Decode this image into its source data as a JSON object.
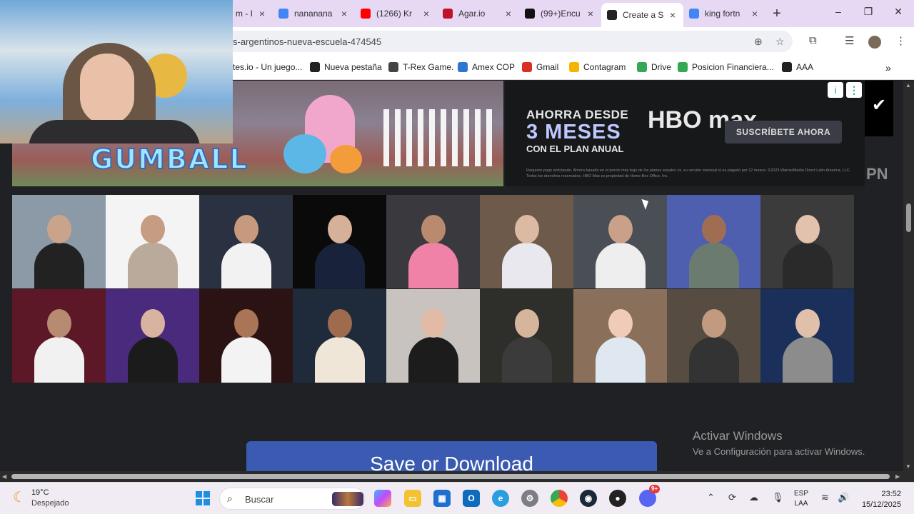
{
  "browser": {
    "tabs": [
      {
        "title": "m - I",
        "icon": "page-icon",
        "color": "#888888"
      },
      {
        "title": "nananana",
        "icon": "google-icon",
        "color": "#4285f4"
      },
      {
        "title": "(1266) Kr",
        "icon": "youtube-icon",
        "color": "#ff0000"
      },
      {
        "title": "Agar.io",
        "icon": "agar-icon",
        "color": "#c0102a"
      },
      {
        "title": "(99+)Encu",
        "icon": "tiktok-icon",
        "color": "#111111"
      },
      {
        "title": "Create a S",
        "icon": "create-icon",
        "color": "#222222",
        "active": true
      },
      {
        "title": "king fortn",
        "icon": "google-icon",
        "color": "#4285f4"
      }
    ],
    "new_tab_symbol": "+",
    "window_controls": {
      "minimize": "–",
      "restore": "❐",
      "close": "✕"
    },
    "url": "s-argentinos-nueva-escuela-474545",
    "bookmarks": [
      {
        "label": "tes.io - Un juego...",
        "icon": "page-icon",
        "color": "#ffffff"
      },
      {
        "label": "Nueva pestaña",
        "icon": "globe-icon",
        "color": "#222222"
      },
      {
        "label": "T-Rex Game.",
        "icon": "dino-icon",
        "color": "#444444"
      },
      {
        "label": "Amex COP",
        "icon": "amex-icon",
        "color": "#2e77d0"
      },
      {
        "label": "Gmail",
        "icon": "gmail-icon",
        "color": "#d93025"
      },
      {
        "label": "Contagram",
        "icon": "contagram-icon",
        "color": "#f4b400"
      },
      {
        "label": "Drive",
        "icon": "drive-icon",
        "color": "#34a853"
      },
      {
        "label": "Posicion Financiera...",
        "icon": "drive-icon",
        "color": "#34a853"
      },
      {
        "label": "AAA",
        "icon": "triangle-icon",
        "color": "#222222"
      }
    ]
  },
  "ad": {
    "line1": "AHORRA DESDE",
    "line2": "3 MESES",
    "line3": "CON EL PLAN ANUAL",
    "brand": "HBO max",
    "cta": "SUSCRÍBETE AHORA",
    "fine_print": "Requiere pago anticipado. Ahorra basado en el precio más bajo de los planes anuales vs. su versión mensual si es pagado por 12 meses. ©2023 WarnerMedia Direct Latin America, LLC. Todos los derechos reservados. HBO Max es propiedad de Home Box Office, Inc.",
    "cartoon_title": "GUMBALL",
    "info_symbol": "i",
    "menu_symbol": "⋮",
    "tag_symbol": "✔",
    "side_text": "PN"
  },
  "photos": [
    {
      "bg": "#8b9aa6",
      "skin": "#c9a48b",
      "top": "#222222"
    },
    {
      "bg": "#f4f4f4",
      "skin": "#c69c82",
      "top": "#b9aa9b"
    },
    {
      "bg": "#2a3140",
      "skin": "#c79a7e",
      "top": "#f2f2f2"
    },
    {
      "bg": "#0a0a0a",
      "skin": "#d6b19a",
      "top": "#18223a"
    },
    {
      "bg": "#3a3a3e",
      "skin": "#b98a6e",
      "top": "#ef82a6"
    },
    {
      "bg": "#6e5a4a",
      "skin": "#dcb9a2",
      "top": "#e8e8ee"
    },
    {
      "bg": "#4a4f56",
      "skin": "#caa089",
      "top": "#eeeeee"
    },
    {
      "bg": "#4f5fb0",
      "skin": "#9f6e52",
      "top": "#6b7b6f"
    },
    {
      "bg": "#3b3b3b",
      "skin": "#e2c1ad",
      "top": "#2a2a2a"
    },
    {
      "bg": "#5c1826",
      "skin": "#b78a72",
      "top": "#f1f1f1"
    },
    {
      "bg": "#4a2a7c",
      "skin": "#d9b3a0",
      "top": "#1b1b1b"
    },
    {
      "bg": "#2c1313",
      "skin": "#a97556",
      "top": "#f3f3f3"
    },
    {
      "bg": "#1f2b3a",
      "skin": "#9e6b4f",
      "top": "#f0e6d8"
    },
    {
      "bg": "#c9c3c0",
      "skin": "#e1bba6",
      "top": "#1c1c1c"
    },
    {
      "bg": "#2e2f2a",
      "skin": "#d6b59d",
      "top": "#3b3b3b"
    },
    {
      "bg": "#8a6f5a",
      "skin": "#f0ccb8",
      "top": "#dfe8f0"
    },
    {
      "bg": "#564c42",
      "skin": "#c29a7f",
      "top": "#333333"
    },
    {
      "bg": "#1a2f5a",
      "skin": "#e0c0aa",
      "top": "#8c8c8c"
    }
  ],
  "page": {
    "activate_title": "Activar Windows",
    "activate_sub": "Ve a Configuración para activar Windows.",
    "save_button": "Save or Download"
  },
  "taskbar": {
    "temperature": "19°C",
    "condition": "Despejado",
    "search_placeholder": "Buscar",
    "lang1": "ESP",
    "lang2": "LAA",
    "time": "23:52",
    "date": "15/12/2025",
    "discord_badge": "9+"
  }
}
